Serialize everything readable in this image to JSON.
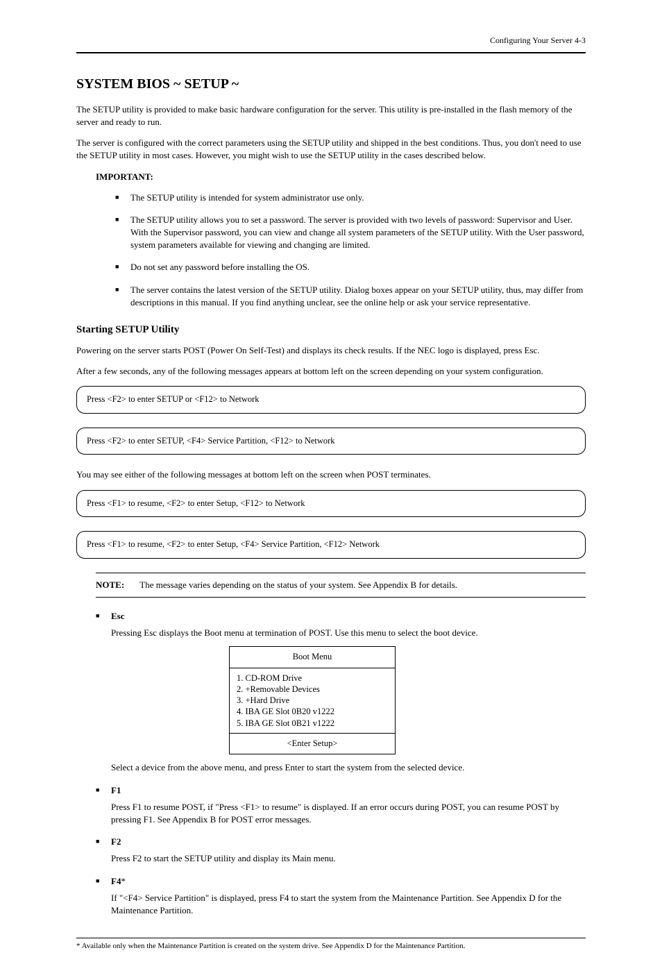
{
  "header": {
    "text": "Configuring Your Server 4-3"
  },
  "section": {
    "title": "SYSTEM BIOS ~ SETUP ~",
    "intro1": "The SETUP utility is provided to make basic hardware configuration for the server. This utility is pre-installed in the flash memory of the server and ready to run.",
    "intro2": "The server is configured with the correct parameters using the SETUP utility and shipped in the best conditions. Thus, you don't need to use the SETUP utility in most cases. However, you might wish to use the SETUP utility in the cases described below."
  },
  "important": {
    "label": "IMPORTANT:",
    "items": [
      "The SETUP utility is intended for system administrator use only.",
      "The SETUP utility allows you to set a password. The server is provided with two levels of password: Supervisor and User. With the Supervisor password, you can view and change all system parameters of the SETUP utility. With the User password, system parameters available for viewing and changing are limited.",
      "Do not set any password before installing the OS.",
      "The server contains the latest version of the SETUP utility. Dialog boxes appear on your SETUP utility, thus, may differ from descriptions in this manual. If you find anything unclear, see the online help or ask your service representative."
    ]
  },
  "starting": {
    "title": "Starting SETUP Utility",
    "p1": "Powering on the server starts POST (Power On Self-Test) and displays its check results. If the NEC logo is displayed, press Esc.",
    "p2": "After a few seconds, any of the following messages appears at bottom left on the screen depending on your system configuration.",
    "messages": [
      "Press <F2> to enter SETUP or <F12> to Network",
      "Press <F2> to enter SETUP, <F4> Service Partition, <F12> to Network",
      "Press <F1> to resume, <F2> to enter Setup, <F12> to Network",
      "Press <F1> to resume, <F2> to enter Setup, <F4> Service Partition, <F12> Network"
    ],
    "p3": "You may see either of the following messages at bottom left on the screen when POST terminates.",
    "note_label": "NOTE:",
    "note_text": "The message varies depending on the status of your system. See Appendix B for details."
  },
  "keys": [
    {
      "head": "Esc",
      "p1": "Pressing Esc displays the Boot menu at termination of POST. Use this menu to select the boot device.",
      "p2": "Select a device from the above menu, and press Enter to start the system from the selected device."
    },
    {
      "head": "F1",
      "p1": "Press F1 to resume POST, if \"Press <F1> to resume\" is displayed. If an error occurs during POST, you can resume POST by pressing F1. See Appendix B for POST error messages."
    },
    {
      "head": "F2",
      "p1": "Press F2 to start the SETUP utility and display its Main menu."
    },
    {
      "head": "F4",
      "p1": "If \"<F4> Service Partition\" is displayed, press F4 to start the system from the Maintenance Partition. See Appendix D for the Maintenance Partition."
    }
  ],
  "boot_menu": {
    "title": "Boot Menu",
    "items": [
      "1. CD-ROM Drive",
      "2. +Removable Devices",
      "3. +Hard Drive",
      "4. IBA GE Slot 0B20 v1222",
      "5. IBA GE Slot 0B21 v1222"
    ],
    "footer": "<Enter Setup>"
  },
  "footnote": "* Available only when the Maintenance Partition is created on the system drive. See Appendix D for the Maintenance Partition."
}
